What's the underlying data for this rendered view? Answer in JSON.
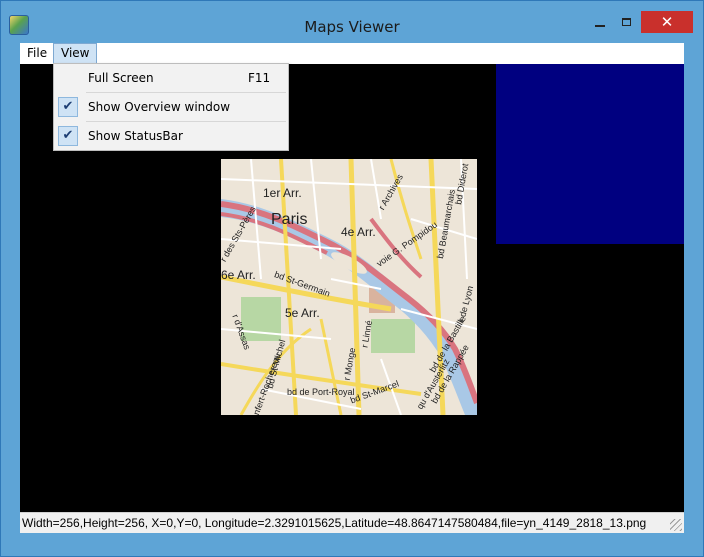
{
  "window": {
    "title": "Maps Viewer",
    "close_glyph": "✕"
  },
  "menubar": {
    "items": [
      "File",
      "View"
    ]
  },
  "view_menu": {
    "items": [
      {
        "label": "Full Screen",
        "shortcut": "F11",
        "checked": false
      },
      {
        "label": "Show Overview window",
        "shortcut": "",
        "checked": true
      },
      {
        "label": "Show StatusBar",
        "shortcut": "",
        "checked": true
      }
    ],
    "check_glyph": "✔"
  },
  "map": {
    "labels": [
      "1er Arr.",
      "Paris",
      "4e Arr.",
      "6e Arr.",
      "5e Arr.",
      "bd St-Germain",
      "bd St-Michel",
      "bd St-Marcel",
      "bd de Port-Royal",
      "r Monge",
      "r Linné",
      "voie G. Pompidou",
      "r Archives",
      "bd Beaumarchais",
      "r de Lyon",
      "bd de la Bastille",
      "bd Diderot",
      "r des Sts-Pères",
      "r d'Assas",
      "r Denfert-Rochereau",
      "bd de la Rappée",
      "qu d'Austerlitz"
    ]
  },
  "statusbar": {
    "text": "Width=256,Height=256, X=0,Y=0, Longitude=2.3291015625,Latitude=48.8647147580484,file=yn_4149_2818_13.png"
  },
  "colors": {
    "frame": "#5ea4d6",
    "canvas": "#000000",
    "overview": "#000080",
    "close": "#c9302c"
  }
}
